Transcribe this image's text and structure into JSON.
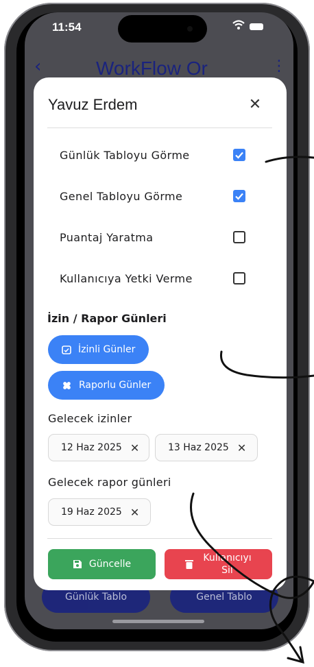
{
  "status_bar": {
    "time": "11:54"
  },
  "app_bar": {
    "title": "WorkFlow Or"
  },
  "bottom_tabs": [
    "Günlük Tablo",
    "Genel Tablo"
  ],
  "dialog": {
    "title": "Yavuz Erdem",
    "permissions": [
      {
        "label": "Günlük Tabloyu Görme",
        "checked": true
      },
      {
        "label": "Genel Tabloyu Görme",
        "checked": true
      },
      {
        "label": "Puantaj Yaratma",
        "checked": false
      },
      {
        "label": "Kullanıcıya Yetki Verme",
        "checked": false
      }
    ],
    "leave_section_title": "İzin / Rapor Günleri",
    "leave_days_button": "İzinli Günler",
    "report_days_button": "Raporlu Günler",
    "upcoming_leaves_label": "Gelecek izinler",
    "upcoming_leaves": [
      "12 Haz 2025",
      "13 Haz 2025"
    ],
    "upcoming_reports_label": "Gelecek rapor günleri",
    "upcoming_reports": [
      "19 Haz 2025"
    ],
    "update_button": "Güncelle",
    "delete_button_line1": "Kullanıcıyı",
    "delete_button_line2": "Sil"
  },
  "colors": {
    "accent": "#3b82f6",
    "update": "#3ba55c",
    "delete": "#e8444f",
    "appbar_text": "#1a237e"
  }
}
